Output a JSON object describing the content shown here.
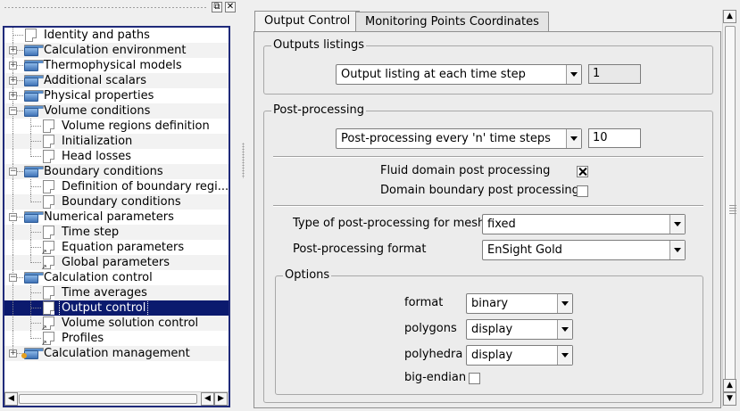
{
  "tree": {
    "items": [
      {
        "label": "Identity and paths",
        "level": 0,
        "icon": "document-icon",
        "expander": "none"
      },
      {
        "label": "Calculation environment",
        "level": 0,
        "icon": "folder-icon",
        "expander": "plus"
      },
      {
        "label": "Thermophysical models",
        "level": 0,
        "icon": "folder-icon",
        "expander": "plus"
      },
      {
        "label": "Additional scalars",
        "level": 0,
        "icon": "folder-icon",
        "expander": "plus"
      },
      {
        "label": "Physical properties",
        "level": 0,
        "icon": "folder-icon",
        "expander": "plus"
      },
      {
        "label": "Volume conditions",
        "level": 0,
        "icon": "folder-icon",
        "expander": "minus"
      },
      {
        "label": "Volume regions definition",
        "level": 1,
        "icon": "document-icon"
      },
      {
        "label": "Initialization",
        "level": 1,
        "icon": "document-icon"
      },
      {
        "label": "Head losses",
        "level": 1,
        "icon": "document-icon"
      },
      {
        "label": "Boundary conditions",
        "level": 0,
        "icon": "folder-icon",
        "expander": "minus"
      },
      {
        "label": "Definition of boundary regi...",
        "level": 1,
        "icon": "document-icon"
      },
      {
        "label": "Boundary conditions",
        "level": 1,
        "icon": "document-icon"
      },
      {
        "label": "Numerical parameters",
        "level": 0,
        "icon": "folder-icon",
        "expander": "minus"
      },
      {
        "label": "Time step",
        "level": 1,
        "icon": "document-icon"
      },
      {
        "label": "Equation parameters",
        "level": 1,
        "icon": "document-shortcut-icon"
      },
      {
        "label": "Global parameters",
        "level": 1,
        "icon": "document-shortcut-icon"
      },
      {
        "label": "Calculation control",
        "level": 0,
        "icon": "folder-icon",
        "expander": "minus"
      },
      {
        "label": "Time averages",
        "level": 1,
        "icon": "document-icon"
      },
      {
        "label": "Output control",
        "level": 1,
        "icon": "document-icon",
        "selected": true
      },
      {
        "label": "Volume solution control",
        "level": 1,
        "icon": "document-shortcut-icon"
      },
      {
        "label": "Profiles",
        "level": 1,
        "icon": "document-shortcut-icon"
      },
      {
        "label": "Calculation management",
        "level": 0,
        "icon": "folder-run-icon",
        "expander": "plus"
      }
    ]
  },
  "tabs": [
    "Output Control",
    "Monitoring Points Coordinates"
  ],
  "outputs_listings": {
    "title": "Outputs listings",
    "mode": "Output listing at each time step",
    "value": "1"
  },
  "post_processing": {
    "title": "Post-processing",
    "mode": "Post-processing every 'n' time steps",
    "value": "10",
    "fluid_domain_label": "Fluid domain post processing",
    "fluid_domain_checked": true,
    "boundary_label": "Domain boundary post processing",
    "boundary_checked": false,
    "mesh_type_label": "Type of post-processing for mesh",
    "mesh_type_value": "fixed",
    "format_label": "Post-processing format",
    "format_value": "EnSight Gold"
  },
  "options": {
    "title": "Options",
    "format_label": "format",
    "format_value": "binary",
    "polygons_label": "polygons",
    "polygons_value": "display",
    "polyhedra_label": "polyhedra",
    "polyhedra_value": "display",
    "big_endian_label": "big-endian",
    "big_endian_checked": false
  },
  "window_buttons": {
    "float": "⧉",
    "close": "✕"
  },
  "scroll_glyphs": {
    "left": "◀",
    "right": "▶",
    "up": "▲",
    "down": "▼"
  },
  "colors": {
    "selection": "#0b1a6e",
    "tree_border": "#1f2a7a",
    "folder": "#3f72b5"
  }
}
